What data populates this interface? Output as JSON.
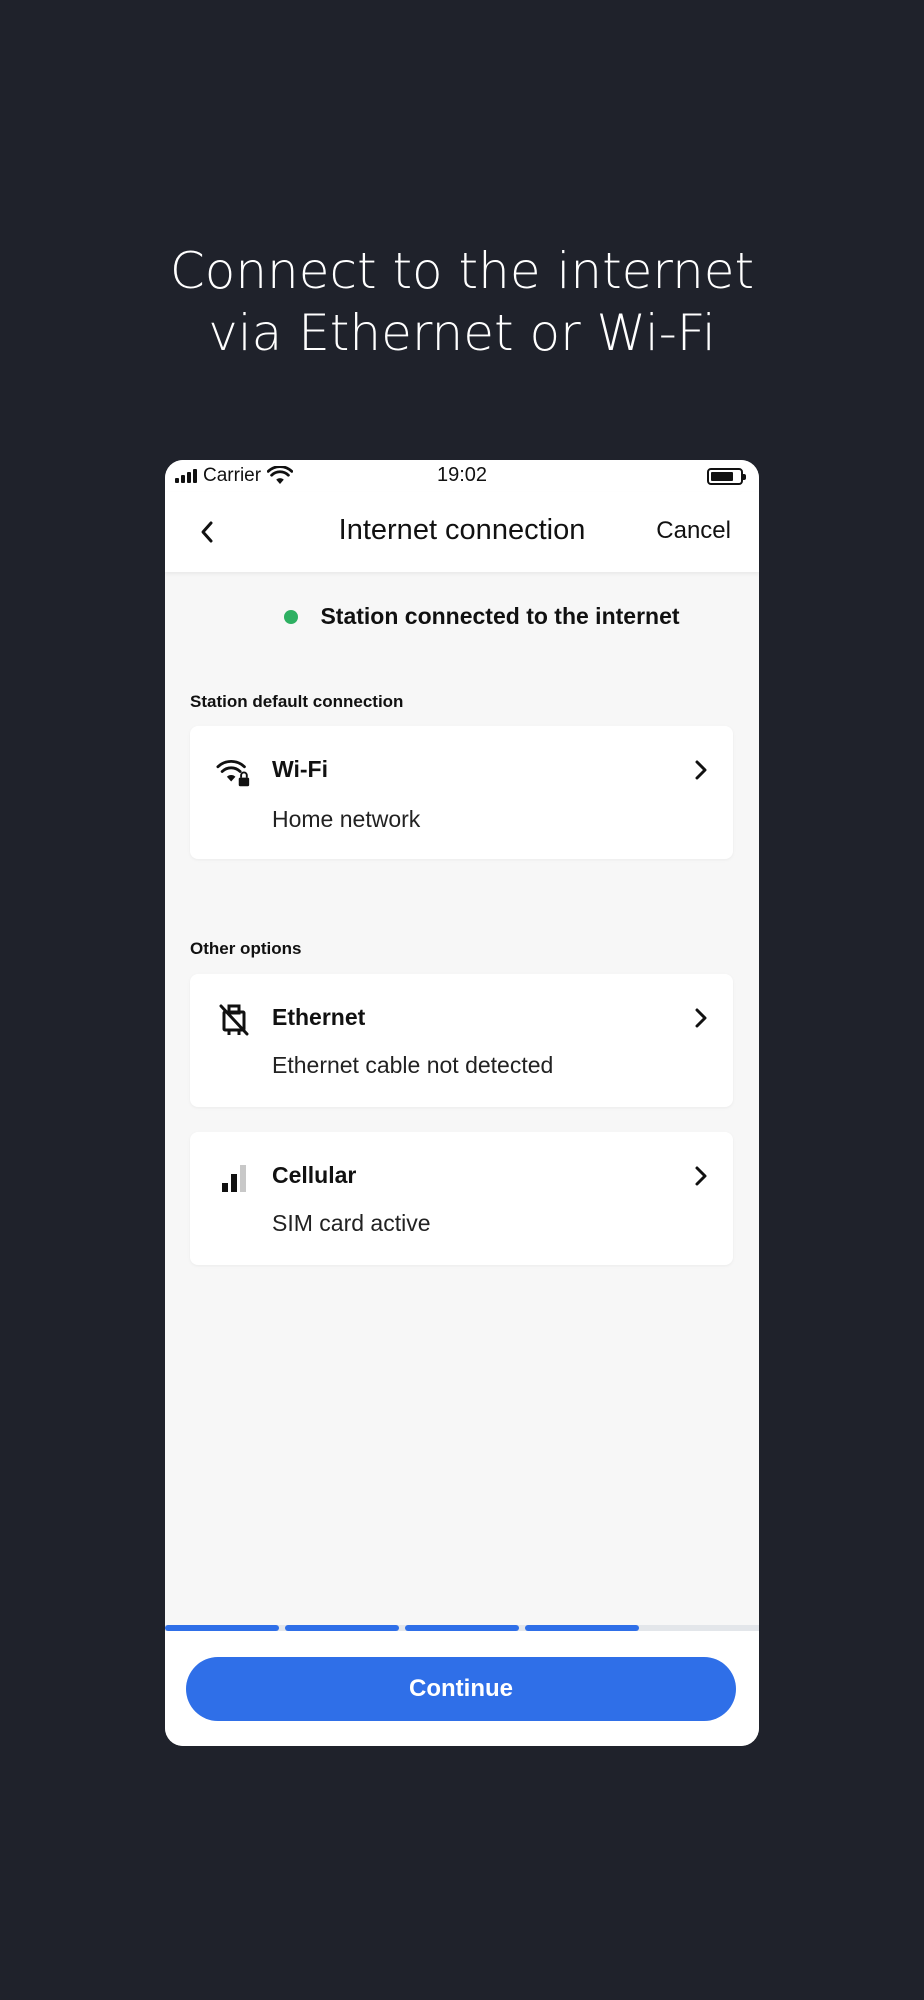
{
  "headline": {
    "line1": "Connect to the internet",
    "line2": "via Ethernet or Wi-Fi"
  },
  "status_bar": {
    "carrier": "Carrier",
    "time": "19:02"
  },
  "nav": {
    "title": "Internet connection",
    "cancel_label": "Cancel",
    "back_icon": "chevron-left-icon"
  },
  "connection_status": {
    "text": "Station connected to the internet",
    "indicator_color": "#2eb062"
  },
  "default_section": {
    "label": "Station default connection",
    "items": [
      {
        "icon": "wifi-lock-icon",
        "title": "Wi-Fi",
        "subtitle": "Home network"
      }
    ]
  },
  "other_section": {
    "label": "Other options",
    "items": [
      {
        "icon": "ethernet-off-icon",
        "title": "Ethernet",
        "subtitle": "Ethernet cable not detected"
      },
      {
        "icon": "cellular-signal-icon",
        "title": "Cellular",
        "subtitle": "SIM card active"
      }
    ]
  },
  "progress": {
    "completed_steps": 4,
    "total_steps": 5,
    "color": "#2f6fe8"
  },
  "footer": {
    "continue_label": "Continue"
  },
  "colors": {
    "background": "#1f222b",
    "accent": "#2f6fe8",
    "success": "#2eb062"
  }
}
